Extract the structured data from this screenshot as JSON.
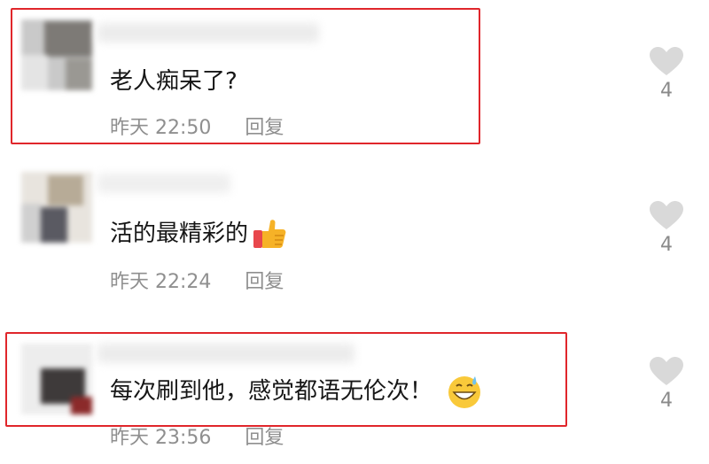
{
  "comments": [
    {
      "text": "老人痴呆了?",
      "time": "昨天 22:50",
      "reply_label": "回复",
      "likes": "4",
      "highlighted": true,
      "emoji": ""
    },
    {
      "text": "活的最精彩的",
      "time": "昨天 22:24",
      "reply_label": "回复",
      "likes": "4",
      "highlighted": false,
      "emoji": "thumbs-up-emoji"
    },
    {
      "text": "每次刷到他，感觉都语无伦次！",
      "time": "昨天 23:56",
      "reply_label": "回复",
      "likes": "4",
      "highlighted": true,
      "emoji": "grinning-sweat-emoji"
    }
  ],
  "colors": {
    "highlight_border": "#e0262b",
    "meta_text": "#8f8f8f",
    "like_icon": "#d9d9d9"
  }
}
